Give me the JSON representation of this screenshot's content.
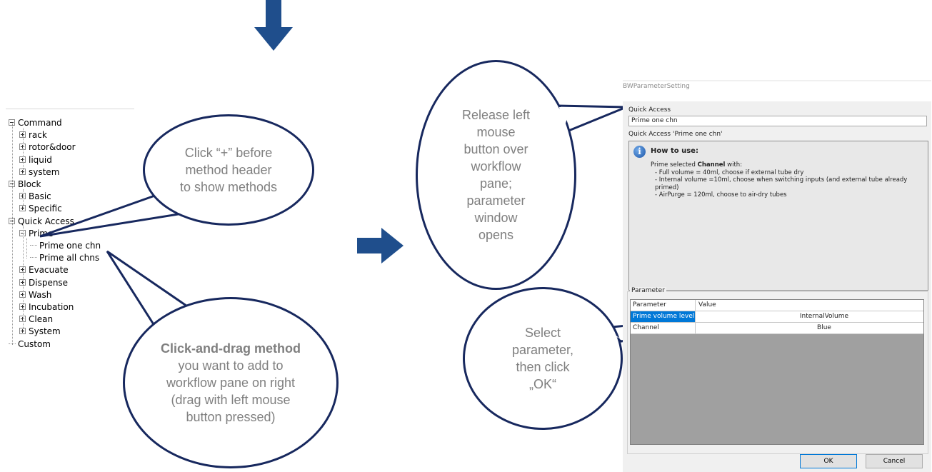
{
  "tree": {
    "items": [
      {
        "label": "Command",
        "toggle": "minus",
        "level": 0
      },
      {
        "label": "rack",
        "toggle": "plus",
        "level": 1
      },
      {
        "label": "rotor&door",
        "toggle": "plus",
        "level": 1
      },
      {
        "label": "liquid",
        "toggle": "plus",
        "level": 1
      },
      {
        "label": "system",
        "toggle": "plus",
        "level": 1
      },
      {
        "label": "Block",
        "toggle": "minus",
        "level": 0
      },
      {
        "label": "Basic",
        "toggle": "plus",
        "level": 1
      },
      {
        "label": "Specific",
        "toggle": "plus",
        "level": 1
      },
      {
        "label": "Quick Access",
        "toggle": "minus",
        "level": 0
      },
      {
        "label": "Prime",
        "toggle": "minus",
        "level": 1
      },
      {
        "label": "Prime one chn",
        "toggle": "none",
        "level": 2
      },
      {
        "label": "Prime all chns",
        "toggle": "none",
        "level": 2
      },
      {
        "label": "Evacuate",
        "toggle": "plus",
        "level": 1
      },
      {
        "label": "Dispense",
        "toggle": "plus",
        "level": 1
      },
      {
        "label": "Wash",
        "toggle": "plus",
        "level": 1
      },
      {
        "label": "Incubation",
        "toggle": "plus",
        "level": 1
      },
      {
        "label": "Clean",
        "toggle": "plus",
        "level": 1
      },
      {
        "label": "System",
        "toggle": "plus",
        "level": 1
      },
      {
        "label": "Custom",
        "toggle": "none",
        "level": 0
      }
    ]
  },
  "callouts": {
    "expand": {
      "lines": [
        "Click “+” before",
        "method header",
        "to show methods"
      ]
    },
    "drag": {
      "bold": "Click-and-drag method",
      "lines": [
        "you want to add to",
        "workflow pane on right",
        "(drag with left mouse",
        "button pressed)"
      ]
    },
    "release": {
      "lines": [
        "Release left",
        "mouse",
        "button over",
        "workflow",
        "pane;",
        "parameter",
        "window",
        "opens"
      ]
    },
    "select": {
      "lines": [
        "Select",
        "parameter,",
        "then click",
        "„OK“"
      ]
    }
  },
  "dialog": {
    "title": "BWParameterSetting",
    "quick_access_label": "Quick Access",
    "quick_access_value": "Prime one chn",
    "info_group_label": "Quick Access 'Prime one chn'",
    "info_title": "How to use:",
    "info_intro_pre": "Prime selected ",
    "info_intro_bold": "Channel",
    "info_intro_post": " with:",
    "info_lines": [
      "- Full volume = 40ml, choose if external tube dry",
      "- Internal volume =10ml, choose when switching inputs (and external tube already primed)",
      "- AirPurge = 120ml, choose to air-dry tubes"
    ],
    "parameter_group_label": "Parameter",
    "grid": {
      "headers": [
        "Parameter",
        "Value"
      ],
      "rows": [
        {
          "name": "Prime volume level",
          "value": "InternalVolume",
          "selected": true
        },
        {
          "name": "Channel",
          "value": "Blue",
          "selected": false
        }
      ]
    },
    "ok_label": "OK",
    "cancel_label": "Cancel"
  },
  "colors": {
    "accent": "#17285e",
    "arrow": "#1f4e8c",
    "selection": "#0078d7",
    "callout_text": "#7f7f7f"
  }
}
